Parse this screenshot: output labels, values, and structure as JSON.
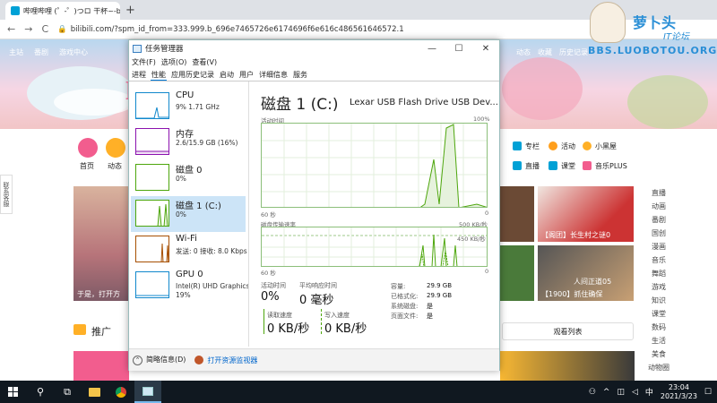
{
  "browser": {
    "tab_title": "哔哩哔哩 (゜-゜)つロ 干杯~-bili",
    "tab_close": "×",
    "new_tab": "+",
    "back": "←",
    "forward": "→",
    "reload": "C",
    "url": "bilibili.com/?spm_id_from=333.999.b_696e7465726e6174696f6e616c486561646572.1"
  },
  "page": {
    "nav_left": [
      "主站",
      "番剧",
      "游戏中心"
    ],
    "nav_right": [
      "动态",
      "收藏",
      "历史记录"
    ],
    "logo": "bilibili",
    "watermark": {
      "line1": "萝卜头",
      "line2": "IT论坛",
      "line3": "BBS.LUOBOTOU.ORG"
    },
    "home_label": "首页",
    "dynamic_label": "动态",
    "channels": [
      {
        "label": "专栏"
      },
      {
        "label": "活动"
      },
      {
        "label": "小黑屋"
      },
      {
        "label": "直播"
      },
      {
        "label": "课堂"
      },
      {
        "label": "音乐PLUS"
      }
    ],
    "feedback": "联系客服",
    "thumb_caption_left": "于是，打开方",
    "thumb_caption_r1": "【阁团】长生村之谜0",
    "thumb_caption_r2": "【1900】抓住确保",
    "thumb_caption_r2b": "人间正道05",
    "promo_label": "推广",
    "watch_list": "观看列表",
    "categories": [
      "直播",
      "动画",
      "番剧",
      "国创",
      "漫画",
      "音乐",
      "舞蹈",
      "游戏",
      "知识",
      "课堂",
      "数码",
      "生活",
      "美食",
      "动物圈"
    ]
  },
  "task_manager": {
    "title": "任务管理器",
    "menu": [
      "文件(F)",
      "选项(O)",
      "查看(V)"
    ],
    "tabs": [
      "进程",
      "性能",
      "应用历史记录",
      "启动",
      "用户",
      "详细信息",
      "服务"
    ],
    "active_tab": "性能",
    "resources": [
      {
        "name": "CPU",
        "value": "9%  1.71 GHz",
        "value2": "",
        "color": "#1188cc"
      },
      {
        "name": "内存",
        "value": "2.6/15.9 GB (16%)",
        "value2": "",
        "color": "#8b12ae"
      },
      {
        "name": "磁盘 0",
        "value": "0%",
        "value2": "",
        "color": "#4da60c"
      },
      {
        "name": "磁盘 1 (C:)",
        "value": "0%",
        "value2": "",
        "color": "#4da60c",
        "selected": true
      },
      {
        "name": "Wi-Fi",
        "value": "发送: 0 接收: 8.0 Kbps",
        "value2": "",
        "color": "#a74f01"
      },
      {
        "name": "GPU 0",
        "value": "Intel(R) UHD Graphics",
        "value2": "19%",
        "color": "#1188cc"
      }
    ],
    "disk": {
      "title": "磁盘 1 (C:)",
      "model": "Lexar USB Flash Drive USB Dev...",
      "graph1_label": "活动时间",
      "graph1_max": "100%",
      "graph1_time": "60 秒",
      "graph1_min": "0",
      "graph2_label": "磁盘传输速率",
      "graph2_max": "500 KB/秒",
      "graph2_mid": "450 KB/秒",
      "graph2_time": "60 秒",
      "graph2_min": "0",
      "active_time_label": "活动时间",
      "active_time": "0%",
      "avg_resp_label": "平均响应时间",
      "avg_resp": "0 毫秒",
      "read_label": "读取速度",
      "read": "0 KB/秒",
      "write_label": "写入速度",
      "write": "0 KB/秒",
      "capacity_label": "容量:",
      "capacity": "29.9 GB",
      "formatted_label": "已格式化:",
      "formatted": "29.9 GB",
      "system_disk_label": "系统磁盘:",
      "system_disk": "是",
      "page_file_label": "页面文件:",
      "page_file": "是"
    },
    "footer_less": "简略信息(D)",
    "footer_monitor": "打开资源监视器"
  },
  "taskbar": {
    "clock_time": "23:04",
    "clock_date": "2021/3/23",
    "ime": "中"
  },
  "colors": {
    "disk_green": "#4da60c",
    "selection": "#cce4f7",
    "taskbar": "#101820"
  }
}
